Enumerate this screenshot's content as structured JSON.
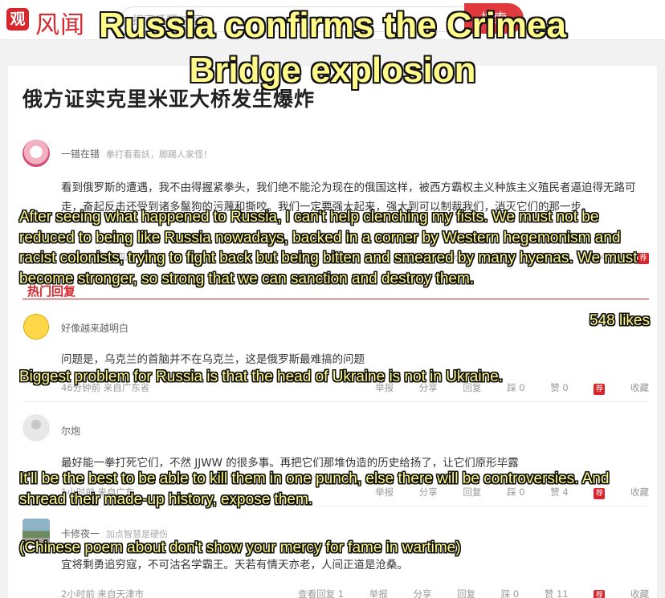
{
  "site": {
    "logo_char": "观",
    "logo_text": "风闻",
    "search_placeholder": "搜索话题/内容",
    "search_button": "搜索"
  },
  "article": {
    "title": "俄方证实克里米亚大桥发生爆炸"
  },
  "section": {
    "hot_comments": "热门回复"
  },
  "comments": [
    {
      "user": "一错在错",
      "motto": "拳打看看妖，脚踢人家怪！",
      "text": "看到俄罗斯的遭遇，我不由得握紧拳头，我们绝不能沦为现在的俄国这样，被西方霸权主义种族主义殖民者逼迫得无路可走，奋起反击还受到诸多鬣狗的污蔑和撕咬。我们一定要强大起来，强大到可以制裁我们，消灭它们的那一步。",
      "meta": "3小时前 来自四川",
      "actions": [
        "举报",
        "分享",
        "回复",
        "踩 0",
        "赞 548"
      ],
      "recommend": "荐"
    },
    {
      "user": "好像越来越明白",
      "text": "问题是，乌克兰的首脑并不在乌克兰，这是俄罗斯最难搞的问题",
      "meta": "46分钟前 来自广东省",
      "actions": [
        "举报",
        "分享",
        "回复",
        "踩 0",
        "赞 0"
      ],
      "recommend": "荐",
      "collect": "收藏"
    },
    {
      "user": "尔炮",
      "text": "最好能一拳打死它们，不然 JJWW 的很多事。再把它们那堆伪造的历史给扬了，让它们原形毕露",
      "meta": "1小时前 来自广东",
      "actions": [
        "举报",
        "分享",
        "回复",
        "踩 0",
        "赞 4"
      ],
      "recommend": "荐",
      "collect": "收藏"
    },
    {
      "user": "卡修夜一",
      "motto": "加点智慧是硬伤",
      "text": "宜将剩勇追穷寇，不可沽名学霸王。天若有情天亦老，人间正道是沧桑。",
      "meta": "2小时前 来自天津市",
      "actions": [
        "查看回复 1",
        "举报",
        "分享",
        "回复",
        "踩 0",
        "赞 11"
      ],
      "recommend": "荐",
      "collect": "收藏"
    }
  ],
  "overlay": {
    "headline_1": "Russia confirms the Crimea",
    "headline_2": "Bridge explosion",
    "cap_1": "After seeing what happened to Russia, I can't help clenching my fists. We must not be reduced to being like Russia nowadays, backed in a corner by Western hegemonism and racist colonists, trying to fight back but being bitten and smeared by many hyenas. We must become stronger, so strong that we can sanction and destroy them.",
    "likes": "548 likes",
    "cap_2": "Biggest problem for Russia is that the head of Ukraine is not in Ukraine.",
    "cap_3": "It'll be the best to be able to kill them in one punch, else there will be controversies. And shread their made-up history, expose them.",
    "cap_4": "(Chinese poem about don't show your mercy for fame in wartime)"
  }
}
